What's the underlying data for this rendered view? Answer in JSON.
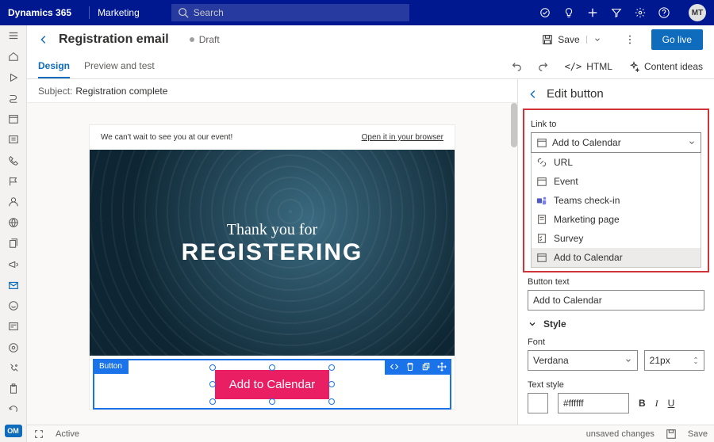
{
  "topbar": {
    "brand": "Dynamics 365",
    "module": "Marketing",
    "search_placeholder": "Search",
    "avatar": "MT"
  },
  "page": {
    "title": "Registration email",
    "status": "Draft",
    "save_label": "Save",
    "golive_label": "Go live"
  },
  "tabs": {
    "design": "Design",
    "preview": "Preview and test"
  },
  "tools": {
    "html": "HTML",
    "ideas": "Content ideas"
  },
  "subject": {
    "label": "Subject:",
    "value": "Registration complete"
  },
  "email": {
    "header_left": "We can't wait to see you at our event!",
    "header_right": "Open it in your browser",
    "hero_line1": "Thank you for",
    "hero_line2": "REGISTERING",
    "block_tag": "Button",
    "cta_text": "Add to Calendar"
  },
  "panel": {
    "title": "Edit button",
    "link_to_label": "Link to",
    "link_to_selected": "Add to Calendar",
    "options": {
      "url": "URL",
      "event": "Event",
      "teams": "Teams check-in",
      "mpage": "Marketing page",
      "survey": "Survey",
      "addcal": "Add to Calendar"
    },
    "button_text_label": "Button text",
    "button_text_value": "Add to Calendar",
    "style_label": "Style",
    "font_label": "Font",
    "font_value": "Verdana",
    "font_size": "21px",
    "text_style_label": "Text style",
    "text_color": "#ffffff"
  },
  "footer": {
    "active": "Active",
    "unsaved": "unsaved changes",
    "save": "Save"
  }
}
